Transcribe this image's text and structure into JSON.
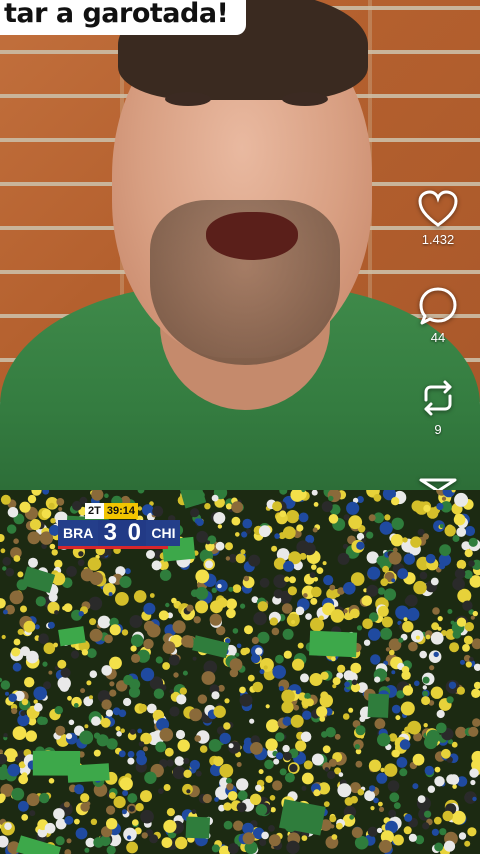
{
  "top_video": {
    "caption": "tar a garotada!"
  },
  "actions": {
    "likes": "1.432",
    "comments": "44",
    "reposts": "9"
  },
  "scoreboard": {
    "half": "2T",
    "clock": "39:14",
    "home_team": "BRA",
    "home_score": "3",
    "away_score": "0",
    "away_team": "CHI"
  },
  "colors": {
    "brick": "#b4602e",
    "shirt": "#347c40",
    "crowd_yellow": "#e7d23a",
    "crowd_green": "#2f7d3c",
    "score_bg": "#243e8a",
    "clock_yellow": "#f2c500"
  },
  "icons": {
    "like": "heart-icon",
    "comment": "comment-bubble-icon",
    "repost": "repost-icon",
    "share": "share-send-icon"
  }
}
